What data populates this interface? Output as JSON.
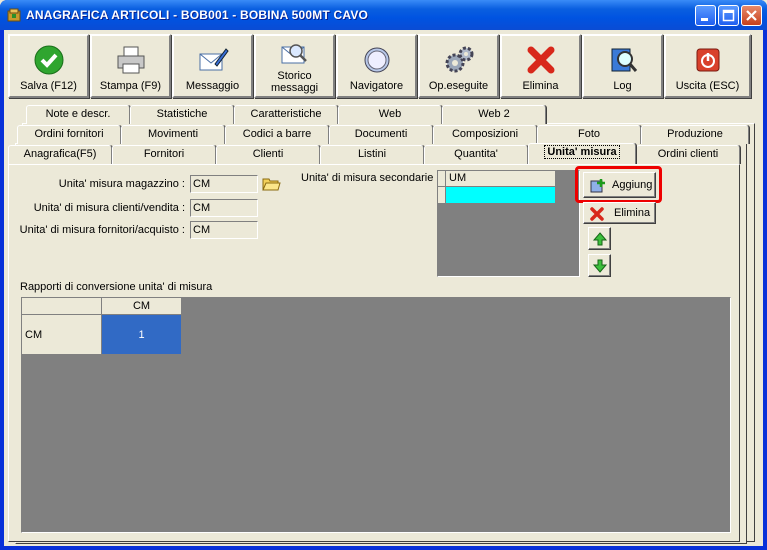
{
  "window": {
    "title": "ANAGRAFICA ARTICOLI - BOB001 - BOBINA 500MT CAVO"
  },
  "toolbar": {
    "buttons": [
      {
        "label": "Salva (F12)",
        "icon": "check-icon"
      },
      {
        "label": "Stampa (F9)",
        "icon": "printer-icon"
      },
      {
        "label": "Messaggio",
        "icon": "envelope-pen-icon"
      },
      {
        "label_line1": "Storico",
        "label_line2": "messaggi",
        "icon": "envelope-search-icon"
      },
      {
        "label": "Navigatore",
        "icon": "compass-icon"
      },
      {
        "label": "Op.eseguite",
        "icon": "gears-icon"
      },
      {
        "label": "Elimina",
        "icon": "red-x-icon"
      },
      {
        "label": "Log",
        "icon": "book-search-icon"
      },
      {
        "label": "Uscita (ESC)",
        "icon": "exit-icon"
      }
    ]
  },
  "tabs": {
    "row1": [
      "Note e descr.",
      "Statistiche",
      "Caratteristiche",
      "Web",
      "Web 2"
    ],
    "row2": [
      "Ordini fornitori",
      "Movimenti",
      "Codici a barre",
      "Documenti",
      "Composizioni",
      "Foto",
      "Produzione"
    ],
    "row3": [
      "Anagrafica(F5)",
      "Fornitori",
      "Clienti",
      "Listini",
      "Quantita'",
      "Unita' misura",
      "Ordini clienti"
    ],
    "active": "Unita' misura"
  },
  "form": {
    "um_magazzino_label": "Unita' misura magazzino :",
    "um_magazzino_value": "CM",
    "um_clienti_label": "Unita' di misura clienti/vendita :",
    "um_clienti_value": "CM",
    "um_fornitori_label": "Unita' di misura fornitori/acquisto :",
    "um_fornitori_value": "CM",
    "um_secondarie_label": "Unita' di misura secondarie :",
    "secondary_list_header": "UM",
    "add_button": "Aggiung",
    "delete_button": "Elimina"
  },
  "conversion": {
    "section_label": "Rapporti di conversione unita' di misura",
    "column_header": "CM",
    "row_header": "CM",
    "cell_value": "1"
  },
  "colors": {
    "selected_cell": "#316ac5",
    "secondary_row": "#00ffff",
    "highlight": "#e00000"
  }
}
